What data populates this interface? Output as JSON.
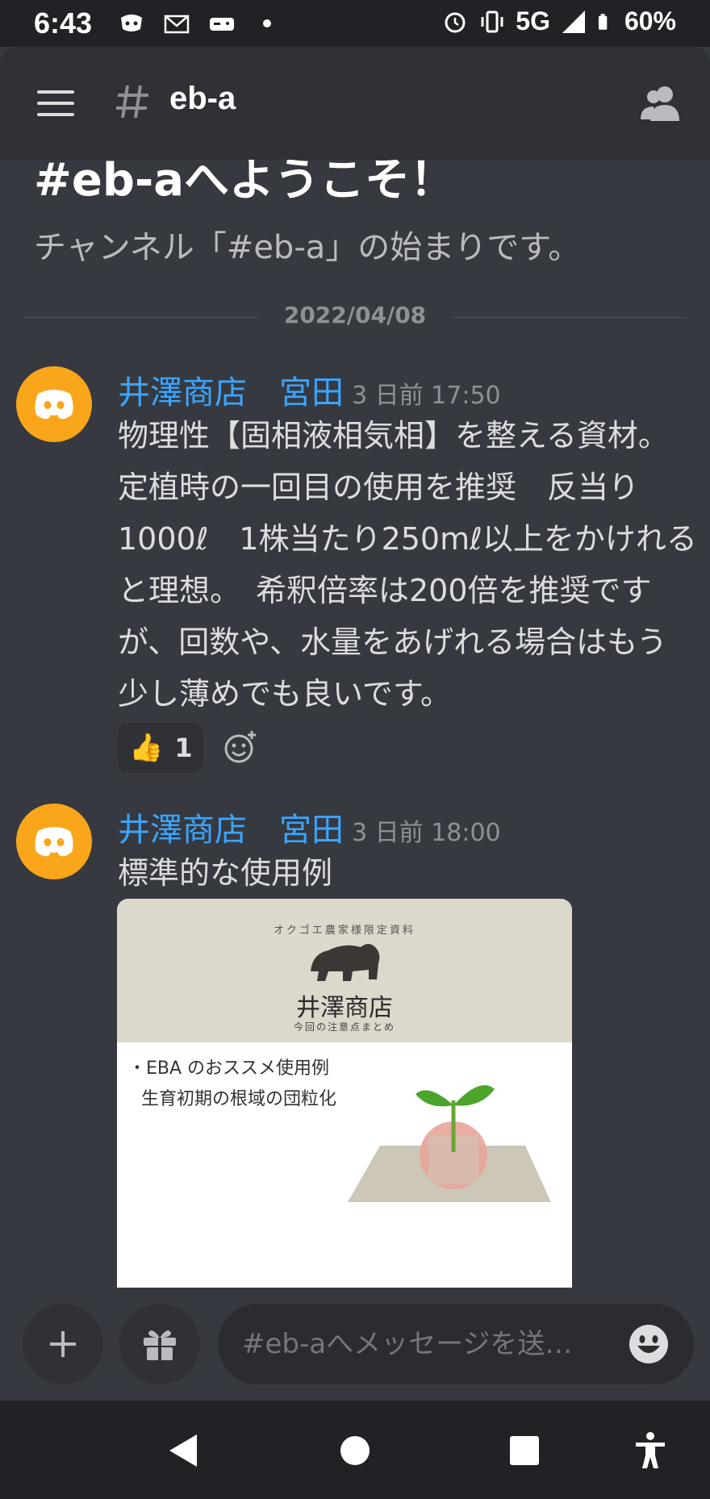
{
  "status_bar": {
    "time": "6:43",
    "network": "5G",
    "battery": "60%",
    "icons": [
      "discord-notification-icon",
      "mail-icon",
      "gamepad-icon",
      "dot-icon",
      "alarm-icon",
      "vibrate-icon",
      "signal-icon",
      "battery-icon"
    ]
  },
  "header": {
    "channel_name": "eb-a",
    "icons": [
      "menu-icon",
      "hash-icon",
      "members-icon"
    ]
  },
  "welcome": {
    "title": "#eb-aへようこそ！",
    "subtitle": "チャンネル「#eb-a」の始まりです。"
  },
  "date_divider": "2022/04/08",
  "messages": [
    {
      "author": "井澤商店　宮田",
      "timestamp": "3 日前 17:50",
      "lines": [
        "物理性【固相液相気相】を整える資材。",
        "定植時の一回目の使用を推奨　反当り",
        "1000ℓ　1株当たり250mℓ以上をかけれる",
        "と理想。　希釈倍率は200倍を推奨です",
        "が、回数や、水量をあげれる場合はもう",
        "少し薄めでも良いです。"
      ],
      "reaction": {
        "emoji": "👍",
        "count": "1"
      }
    },
    {
      "author": "井澤商店　宮田",
      "timestamp": "3 日前 18:00",
      "lines": [
        "標準的な使用例"
      ],
      "attachment": {
        "arc_text": "オクゴエ農家様限定資料",
        "shop_name": "井澤商店",
        "note": "今回の注意点まとめ",
        "bullet_line1": "・EBA のおススメ使用例",
        "bullet_line2": "生育初期の根域の団粒化"
      }
    }
  ],
  "composer": {
    "placeholder": "#eb-aへメッセージを送…"
  },
  "colors": {
    "background": "#36393f",
    "header": "#2f3136",
    "author": "#3ba5ff",
    "avatar": "#faa61a"
  }
}
